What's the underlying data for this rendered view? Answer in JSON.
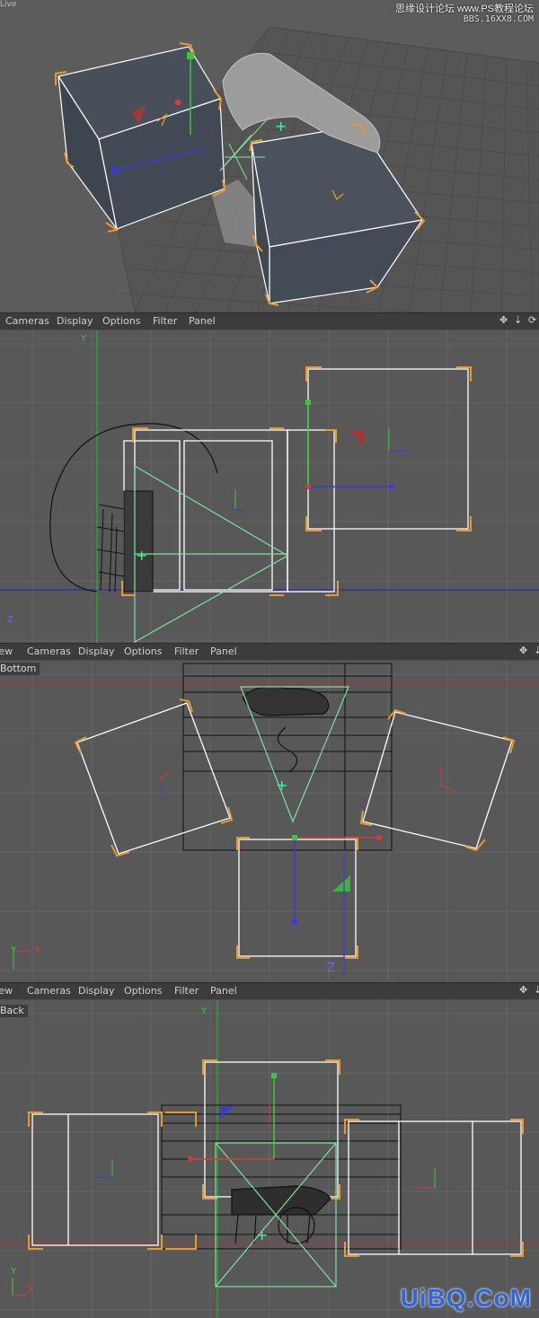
{
  "watermark_top": {
    "line1": "思缘设计论坛 www.PS教程论坛",
    "line2": "BBS.16XX8.COM"
  },
  "perspective_view": {
    "label": "Live"
  },
  "right_view": {
    "menu": [
      "Cameras",
      "Display",
      "Options",
      "Filter",
      "Panel"
    ],
    "axis_y": "Y",
    "axis_z": "Z"
  },
  "bottom_view": {
    "menu": [
      "View",
      "Cameras",
      "Display",
      "Options",
      "Filter",
      "Panel"
    ],
    "label": "Bottom",
    "axis_y": "Y",
    "axis_x": "X",
    "axis_z": "Z"
  },
  "back_view": {
    "menu": [
      "View",
      "Cameras",
      "Display",
      "Options",
      "Filter",
      "Panel"
    ],
    "label": "Back",
    "axis_y": "Y",
    "axis_x": "X"
  },
  "viewport_controls": {
    "move": "✥",
    "zoom": "⇣",
    "rotate": "⟳",
    "maximize": "⧉"
  },
  "watermark_bottom": "UiBQ.CoM",
  "colors": {
    "viewport_bg": "#585858",
    "grid": "#666666",
    "menubar": "#3c3c3c",
    "selection_orange": "#e89a2a",
    "light_cone": "#7fe0a0",
    "axis_red": "#d83a3a",
    "axis_green": "#3ac83a",
    "axis_blue": "#3a3ad8"
  }
}
